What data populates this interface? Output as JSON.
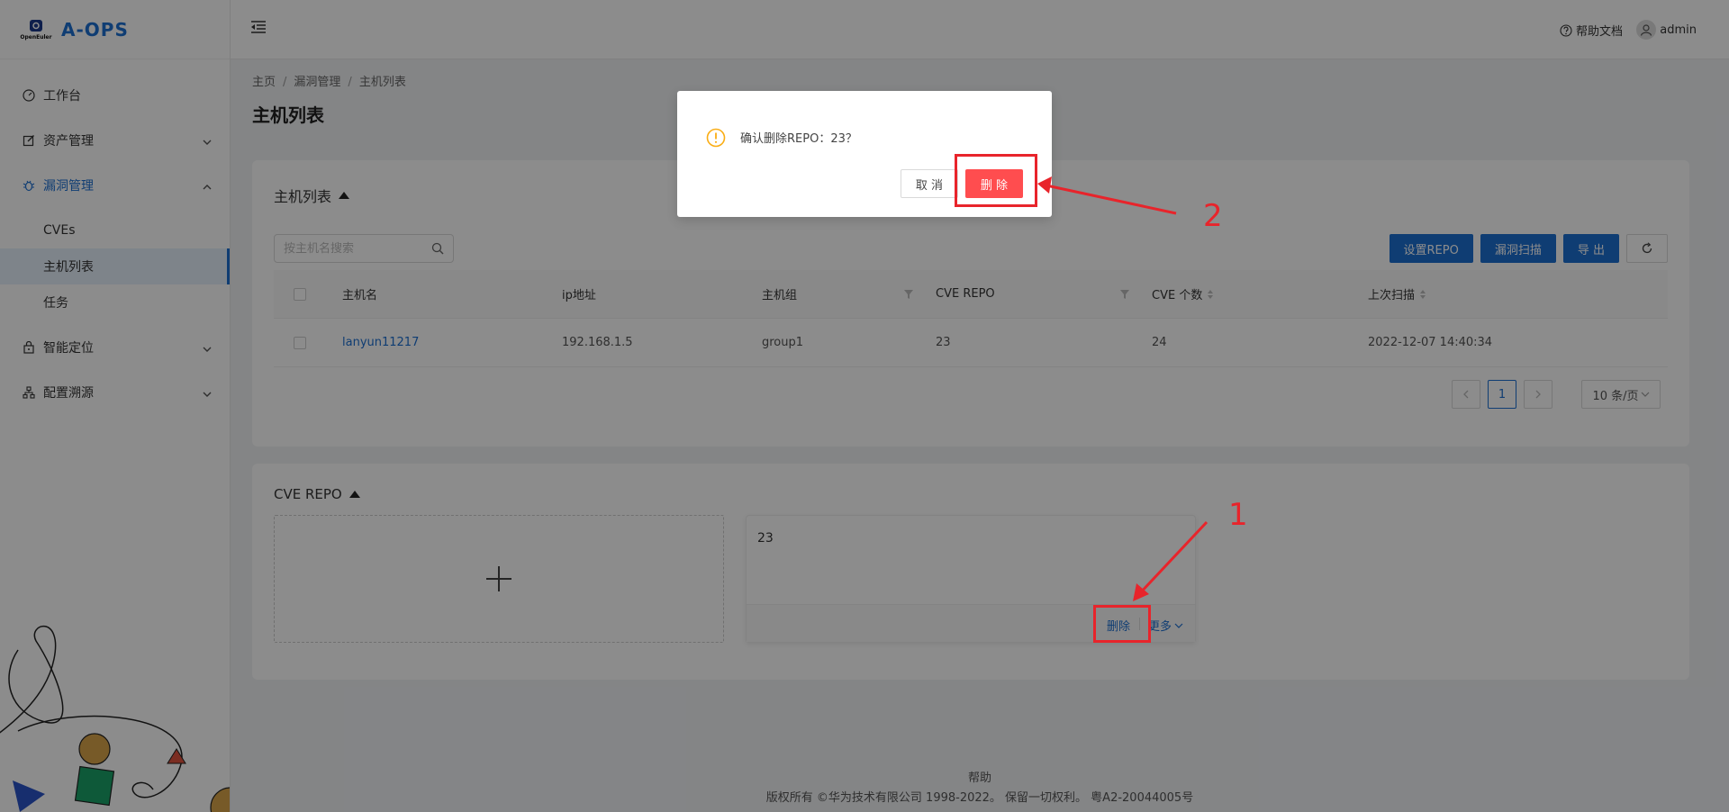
{
  "app": {
    "logo_sub": "OpenEuler",
    "title": "A-OPS"
  },
  "sidebar": {
    "items": [
      {
        "label": "工作台",
        "icon": "dashboard-icon"
      },
      {
        "label": "资产管理",
        "icon": "edit-icon",
        "chevron": "down"
      },
      {
        "label": "漏洞管理",
        "icon": "bug-icon",
        "chevron": "up",
        "open": true
      },
      {
        "label": "智能定位",
        "icon": "lock-icon",
        "chevron": "down"
      },
      {
        "label": "配置溯源",
        "icon": "cluster-icon",
        "chevron": "down"
      }
    ],
    "submenu": [
      {
        "label": "CVEs"
      },
      {
        "label": "主机列表",
        "active": true
      },
      {
        "label": "任务"
      }
    ]
  },
  "header": {
    "help_label": "帮助文档",
    "user_label": "admin"
  },
  "breadcrumb": {
    "home": "主页",
    "section": "漏洞管理",
    "current": "主机列表"
  },
  "page_title": "主机列表",
  "host_card": {
    "title": "主机列表",
    "search_placeholder": "按主机名搜索",
    "buttons": {
      "set_repo": "设置REPO",
      "scan": "漏洞扫描",
      "export": "导 出"
    },
    "columns": [
      "主机名",
      "ip地址",
      "主机组",
      "CVE REPO",
      "CVE 个数",
      "上次扫描"
    ],
    "rows": [
      {
        "host": "lanyun11217",
        "ip": "192.168.1.5",
        "group": "group1",
        "repo": "23",
        "cve_count": "24",
        "last_scan": "2022-12-07 14:40:34"
      }
    ],
    "pagination": {
      "current_page": "1",
      "page_size": "10 条/页"
    }
  },
  "repo_card": {
    "title": "CVE REPO",
    "repo_name": "23",
    "delete_label": "删除",
    "more_label": "更多"
  },
  "footer": {
    "help": "帮助",
    "copyright": "版权所有 ©华为技术有限公司 1998-2022。 保留一切权利。 粤A2-20044005号"
  },
  "modal": {
    "message": "确认删除REPO：23？",
    "cancel_label": "取 消",
    "confirm_label": "删 除"
  },
  "annotations": {
    "step1": "1",
    "step2": "2"
  },
  "colors": {
    "primary": "#1d6fd1",
    "danger": "#ff4d4f",
    "warning": "#faad14",
    "annotation": "#e8242b"
  }
}
